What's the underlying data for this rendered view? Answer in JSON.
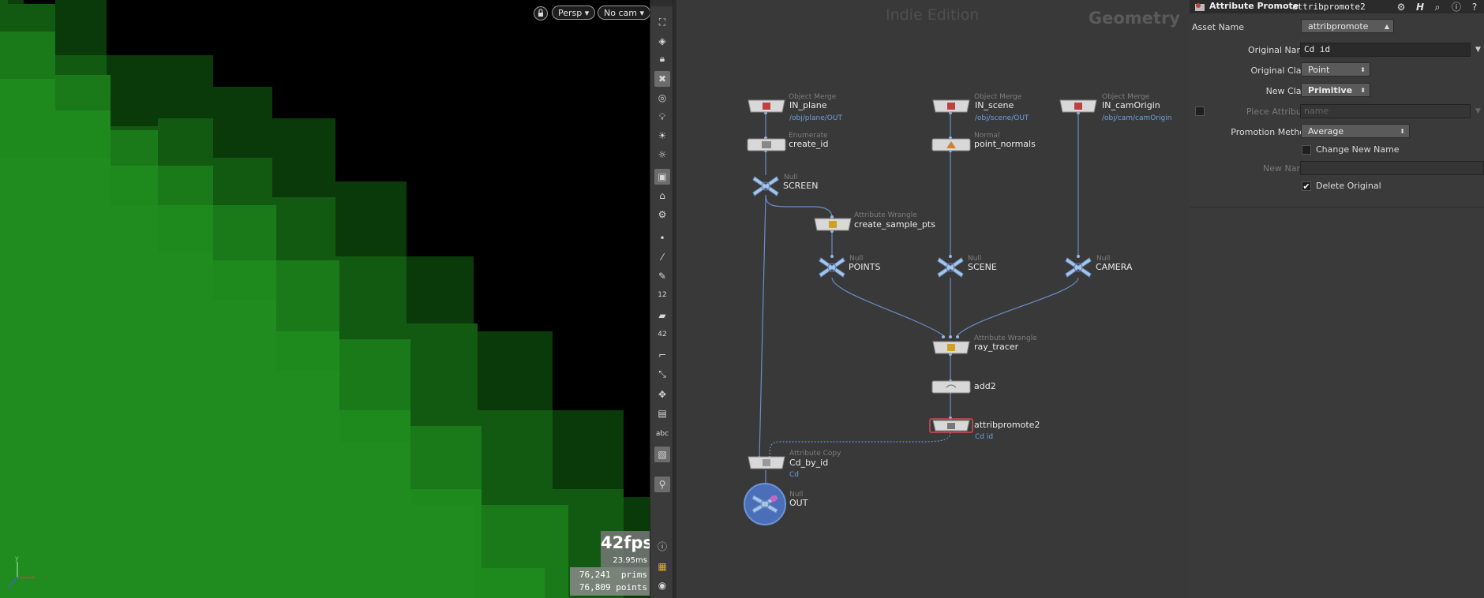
{
  "viewport": {
    "persp_label": "Persp",
    "cam_label": "No cam",
    "fps": "42fps",
    "ms": "23.95ms",
    "prims": "76,241  prims",
    "points": "76,809 points"
  },
  "toolbar": {
    "icons": [
      "select-icon",
      "visibility-icon",
      "lock-icon",
      "snap-icon",
      "shading-icon",
      "light-icon",
      "light-icon-2",
      "light-icon-3",
      "display-icon",
      "view-icon",
      "camera-icon",
      "point-icon",
      "brush-icon",
      "pen-icon",
      "number-icon",
      "eraser-icon",
      "number-icon-2",
      "guide-icon",
      "transform-icon",
      "handle-icon",
      "list-icon",
      "text-label-icon",
      "image-icon",
      "pin-icon",
      "info-icon",
      "grid-icon",
      "eye-icon"
    ],
    "text_label": "abc",
    "num_label_1": "12",
    "num_label_2": "42"
  },
  "network": {
    "edition": "Indie Edition",
    "context": "Geometry",
    "nodes": [
      {
        "id": "in_plane",
        "type": "Object Merge",
        "name": "IN_plane",
        "sub": "/obj/plane/OUT"
      },
      {
        "id": "in_scene",
        "type": "Object Merge",
        "name": "IN_scene",
        "sub": "/obj/scene/OUT"
      },
      {
        "id": "in_camorigin",
        "type": "Object Merge",
        "name": "IN_camOrigin",
        "sub": "/obj/cam/camOrigin"
      },
      {
        "id": "create_id",
        "type": "Enumerate",
        "name": "create_id",
        "sub": ""
      },
      {
        "id": "point_normals",
        "type": "Normal",
        "name": "point_normals",
        "sub": ""
      },
      {
        "id": "screen",
        "type": "Null",
        "name": "SCREEN",
        "sub": ""
      },
      {
        "id": "create_sample_pts",
        "type": "Attribute Wrangle",
        "name": "create_sample_pts",
        "sub": ""
      },
      {
        "id": "points",
        "type": "Null",
        "name": "POINTS",
        "sub": ""
      },
      {
        "id": "scene",
        "type": "Null",
        "name": "SCENE",
        "sub": ""
      },
      {
        "id": "camera",
        "type": "Null",
        "name": "CAMERA",
        "sub": ""
      },
      {
        "id": "ray_tracer",
        "type": "Attribute Wrangle",
        "name": "ray_tracer",
        "sub": ""
      },
      {
        "id": "add2",
        "type": "",
        "name": "add2",
        "sub": ""
      },
      {
        "id": "attribpromote2",
        "type": "",
        "name": "attribpromote2",
        "sub": "Cd id"
      },
      {
        "id": "cd_by_id",
        "type": "Attribute Copy",
        "name": "Cd_by_id",
        "sub": "Cd"
      },
      {
        "id": "out",
        "type": "Null",
        "name": "OUT",
        "sub": ""
      }
    ]
  },
  "params": {
    "title": "Attribute Promote",
    "node_name": "attribpromote2",
    "asset_name_label": "Asset Name",
    "asset_name_value": "attribpromote",
    "original_name_label": "Original Name",
    "original_name_value": "Cd id",
    "original_class_label": "Original Class",
    "original_class_value": "Point",
    "new_class_label": "New Class",
    "new_class_value": "Primitive",
    "piece_attribute_label": "Piece Attribute",
    "piece_attribute_placeholder": "name",
    "promotion_method_label": "Promotion Method",
    "promotion_method_value": "Average",
    "change_new_name_label": "Change New Name",
    "new_name_label": "New Name",
    "delete_original_label": "Delete Original"
  }
}
